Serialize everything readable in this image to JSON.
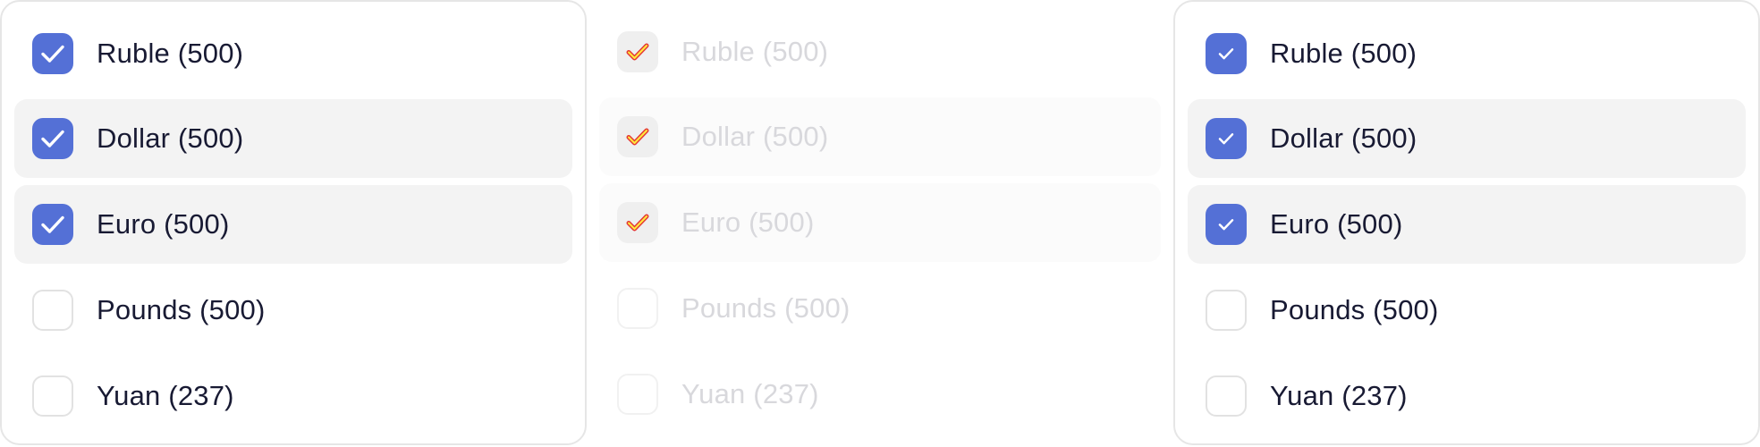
{
  "panels": [
    {
      "state": "default",
      "items": [
        {
          "label": "Ruble (500)",
          "checked": true
        },
        {
          "label": "Dollar (500)",
          "checked": true
        },
        {
          "label": "Euro (500)",
          "checked": true
        },
        {
          "label": "Pounds (500)",
          "checked": false
        },
        {
          "label": "Yuan (237)",
          "checked": false
        }
      ]
    },
    {
      "state": "disabled",
      "items": [
        {
          "label": "Ruble (500)",
          "checked": true
        },
        {
          "label": "Dollar (500)",
          "checked": true
        },
        {
          "label": "Euro (500)",
          "checked": true
        },
        {
          "label": "Pounds (500)",
          "checked": false
        },
        {
          "label": "Yuan (237)",
          "checked": false
        }
      ]
    },
    {
      "state": "default",
      "items": [
        {
          "label": "Ruble (500)",
          "checked": true
        },
        {
          "label": "Dollar (500)",
          "checked": true
        },
        {
          "label": "Euro (500)",
          "checked": true
        },
        {
          "label": "Pounds (500)",
          "checked": false
        },
        {
          "label": "Yuan (237)",
          "checked": false
        }
      ]
    }
  ],
  "colors": {
    "accent": "#5470d6",
    "text": "#181a33",
    "text_disabled": "#d8d8dc",
    "row_highlight": "#f3f3f3",
    "disabled_check_stroke": "#e53935",
    "disabled_check_fill": "#ffeb3b"
  }
}
